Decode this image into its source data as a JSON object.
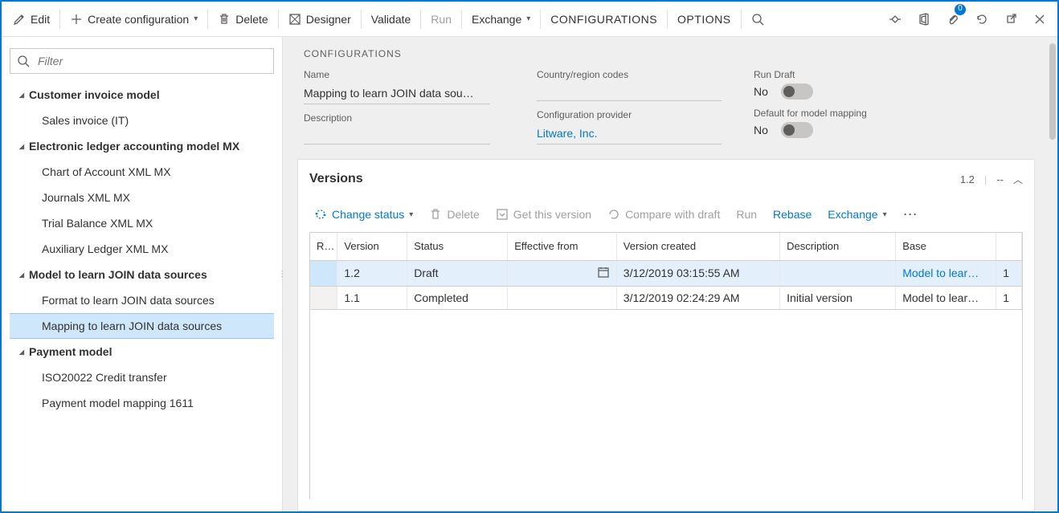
{
  "toolbar": {
    "edit": "Edit",
    "create": "Create configuration",
    "delete": "Delete",
    "designer": "Designer",
    "validate": "Validate",
    "run": "Run",
    "exchange": "Exchange",
    "configurations": "CONFIGURATIONS",
    "options": "OPTIONS",
    "attach_count": "0"
  },
  "filter_placeholder": "Filter",
  "tree": [
    {
      "label": "Customer invoice model",
      "type": "parent"
    },
    {
      "label": "Sales invoice (IT)",
      "type": "child"
    },
    {
      "label": "Electronic ledger accounting model MX",
      "type": "parent"
    },
    {
      "label": "Chart of Account XML MX",
      "type": "child"
    },
    {
      "label": "Journals XML MX",
      "type": "child"
    },
    {
      "label": "Trial Balance XML MX",
      "type": "child"
    },
    {
      "label": "Auxiliary Ledger XML MX",
      "type": "child"
    },
    {
      "label": "Model to learn JOIN data sources",
      "type": "parent"
    },
    {
      "label": "Format to learn JOIN data sources",
      "type": "child"
    },
    {
      "label": "Mapping to learn JOIN data sources",
      "type": "child",
      "selected": true
    },
    {
      "label": "Payment model",
      "type": "parent"
    },
    {
      "label": "ISO20022 Credit transfer",
      "type": "child"
    },
    {
      "label": "Payment model mapping 1611",
      "type": "child"
    }
  ],
  "section_title": "CONFIGURATIONS",
  "fields": {
    "name_label": "Name",
    "name_value": "Mapping to learn JOIN data sou…",
    "desc_label": "Description",
    "desc_value": "",
    "country_label": "Country/region codes",
    "country_value": "",
    "provider_label": "Configuration provider",
    "provider_value": "Litware, Inc.",
    "rundraft_label": "Run Draft",
    "rundraft_value": "No",
    "defmap_label": "Default for model mapping",
    "defmap_value": "No"
  },
  "versions": {
    "title": "Versions",
    "current": "1.2",
    "dash": "--",
    "tools": {
      "change_status": "Change status",
      "delete": "Delete",
      "get_version": "Get this version",
      "compare": "Compare with draft",
      "run": "Run",
      "rebase": "Rebase",
      "exchange": "Exchange"
    },
    "columns": [
      "R…",
      "Version",
      "Status",
      "Effective from",
      "Version created",
      "Description",
      "Base",
      ""
    ],
    "rows": [
      {
        "r": "",
        "version": "1.2",
        "status": "Draft",
        "effective": "",
        "created": "3/12/2019 03:15:55 AM",
        "desc": "",
        "base": "Model to lear…",
        "basev": "1",
        "selected": true
      },
      {
        "r": "",
        "version": "1.1",
        "status": "Completed",
        "effective": "",
        "created": "3/12/2019 02:24:29 AM",
        "desc": "Initial version",
        "base": "Model to lear…",
        "basev": "1",
        "selected": false
      }
    ]
  }
}
